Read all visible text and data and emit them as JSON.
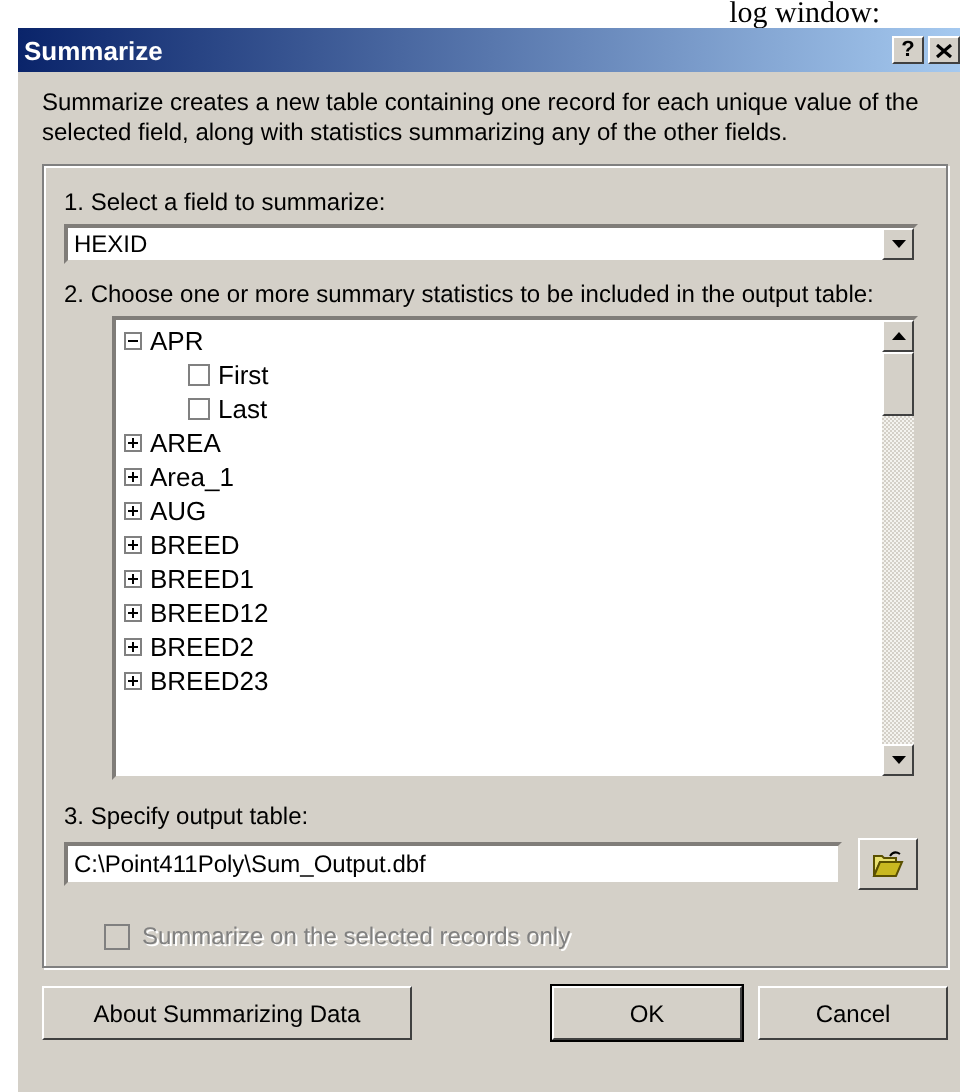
{
  "document_text": "log window:",
  "window": {
    "title": "Summarize",
    "help": "?"
  },
  "description": "Summarize creates a new table containing one record for each unique value of the selected field, along with statistics summarizing any of the other fields.",
  "step1": {
    "label": "1. Select a field to summarize:",
    "value": "HEXID"
  },
  "step2": {
    "label": "2. Choose one or more summary statistics to be included in the output table:",
    "tree": [
      {
        "label": "APR",
        "expanded": true,
        "children": [
          {
            "label": "First",
            "checked": false
          },
          {
            "label": "Last",
            "checked": false
          }
        ]
      },
      {
        "label": "AREA",
        "expanded": false
      },
      {
        "label": "Area_1",
        "expanded": false
      },
      {
        "label": "AUG",
        "expanded": false
      },
      {
        "label": "BREED",
        "expanded": false
      },
      {
        "label": "BREED1",
        "expanded": false
      },
      {
        "label": "BREED12",
        "expanded": false
      },
      {
        "label": "BREED2",
        "expanded": false
      },
      {
        "label": "BREED23",
        "expanded": false
      }
    ]
  },
  "step3": {
    "label": "3. Specify output table:",
    "value": "C:\\Point411Poly\\Sum_Output.dbf"
  },
  "selected_only": {
    "label": "Summarize on the selected records only",
    "checked": false,
    "disabled": true
  },
  "buttons": [
    {
      "label": "About Summarizing Data",
      "kind": "help"
    },
    {
      "label": "OK",
      "kind": "default"
    },
    {
      "label": "Cancel",
      "kind": "normal"
    }
  ]
}
